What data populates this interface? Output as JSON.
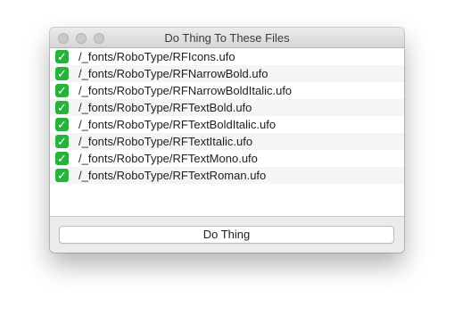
{
  "window": {
    "title": "Do Thing To These Files"
  },
  "files": [
    {
      "path": "/_fonts/RoboType/RFIcons.ufo",
      "checked": true
    },
    {
      "path": "/_fonts/RoboType/RFNarrowBold.ufo",
      "checked": true
    },
    {
      "path": "/_fonts/RoboType/RFNarrowBoldItalic.ufo",
      "checked": true
    },
    {
      "path": "/_fonts/RoboType/RFTextBold.ufo",
      "checked": true
    },
    {
      "path": "/_fonts/RoboType/RFTextBoldItalic.ufo",
      "checked": true
    },
    {
      "path": "/_fonts/RoboType/RFTextItalic.ufo",
      "checked": true
    },
    {
      "path": "/_fonts/RoboType/RFTextMono.ufo",
      "checked": true
    },
    {
      "path": "/_fonts/RoboType/RFTextRoman.ufo",
      "checked": true
    }
  ],
  "actions": {
    "do_thing_label": "Do Thing"
  },
  "icons": {
    "check": "check-icon",
    "close": "close-icon",
    "minimize": "minimize-icon",
    "zoom": "zoom-icon"
  },
  "colors": {
    "check_green": "#25b33a"
  }
}
